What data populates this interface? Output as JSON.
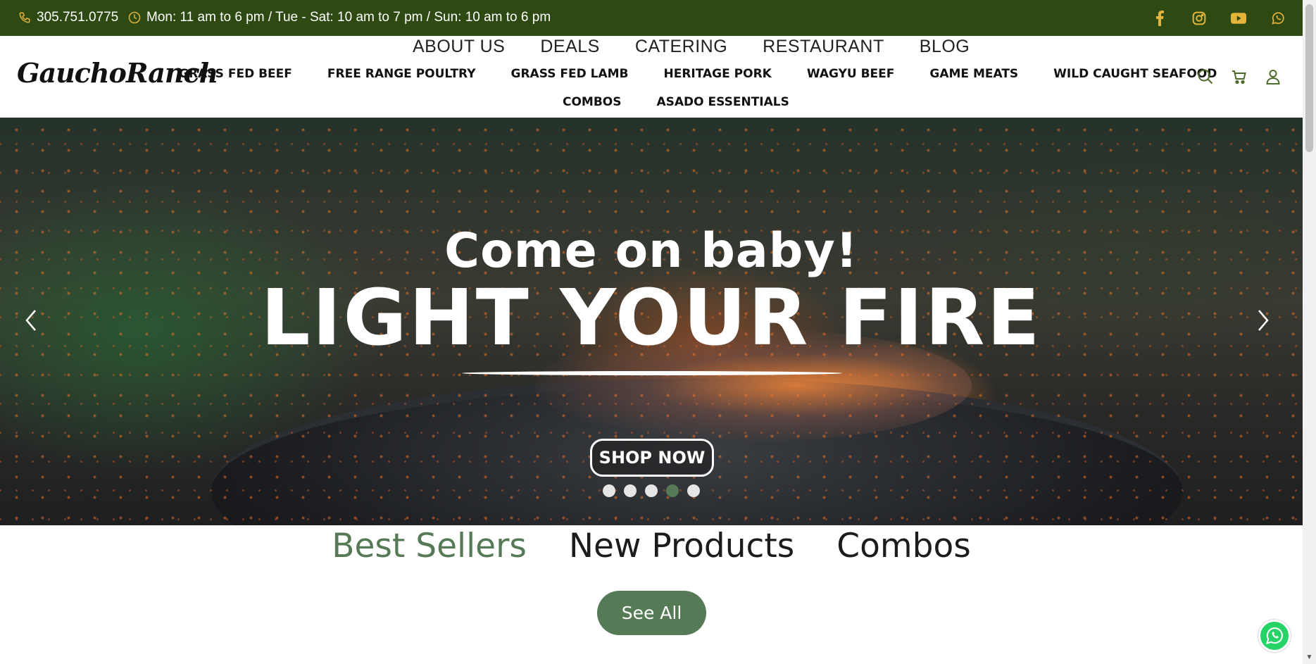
{
  "topbar": {
    "phone": "305.751.0775",
    "hours": "Mon: 11 am to 6 pm / Tue - Sat: 10 am to 7 pm / Sun: 10 am to 6 pm",
    "icon_color": "#e3b33c",
    "background": "#2e4a12",
    "social_icons": [
      "facebook-icon",
      "instagram-icon",
      "youtube-icon",
      "whatsapp-icon"
    ]
  },
  "header": {
    "logo": "GauchoRanch",
    "top_nav": [
      "ABOUT US",
      "DEALS",
      "CATERING",
      "RESTAURANT",
      "BLOG"
    ],
    "categories": [
      "GRASS FED BEEF",
      "FREE RANGE POULTRY",
      "GRASS FED LAMB",
      "HERITAGE PORK",
      "WAGYU BEEF",
      "GAME MEATS",
      "WILD CAUGHT SEAFOOD"
    ],
    "categories_row2": [
      "COMBOS",
      "ASADO ESSENTIALS"
    ],
    "icons": [
      "search-icon",
      "cart-icon",
      "user-icon"
    ]
  },
  "hero": {
    "subtitle": "Come on baby!",
    "title": "LIGHT YOUR FIRE",
    "button": "SHOP NOW",
    "slide_count": 5,
    "active_slide": 4
  },
  "tabs": {
    "items": [
      "Best Sellers",
      "New Products",
      "Combos"
    ],
    "active": "Best Sellers",
    "accent": "#567a56"
  },
  "see_all": "See All"
}
